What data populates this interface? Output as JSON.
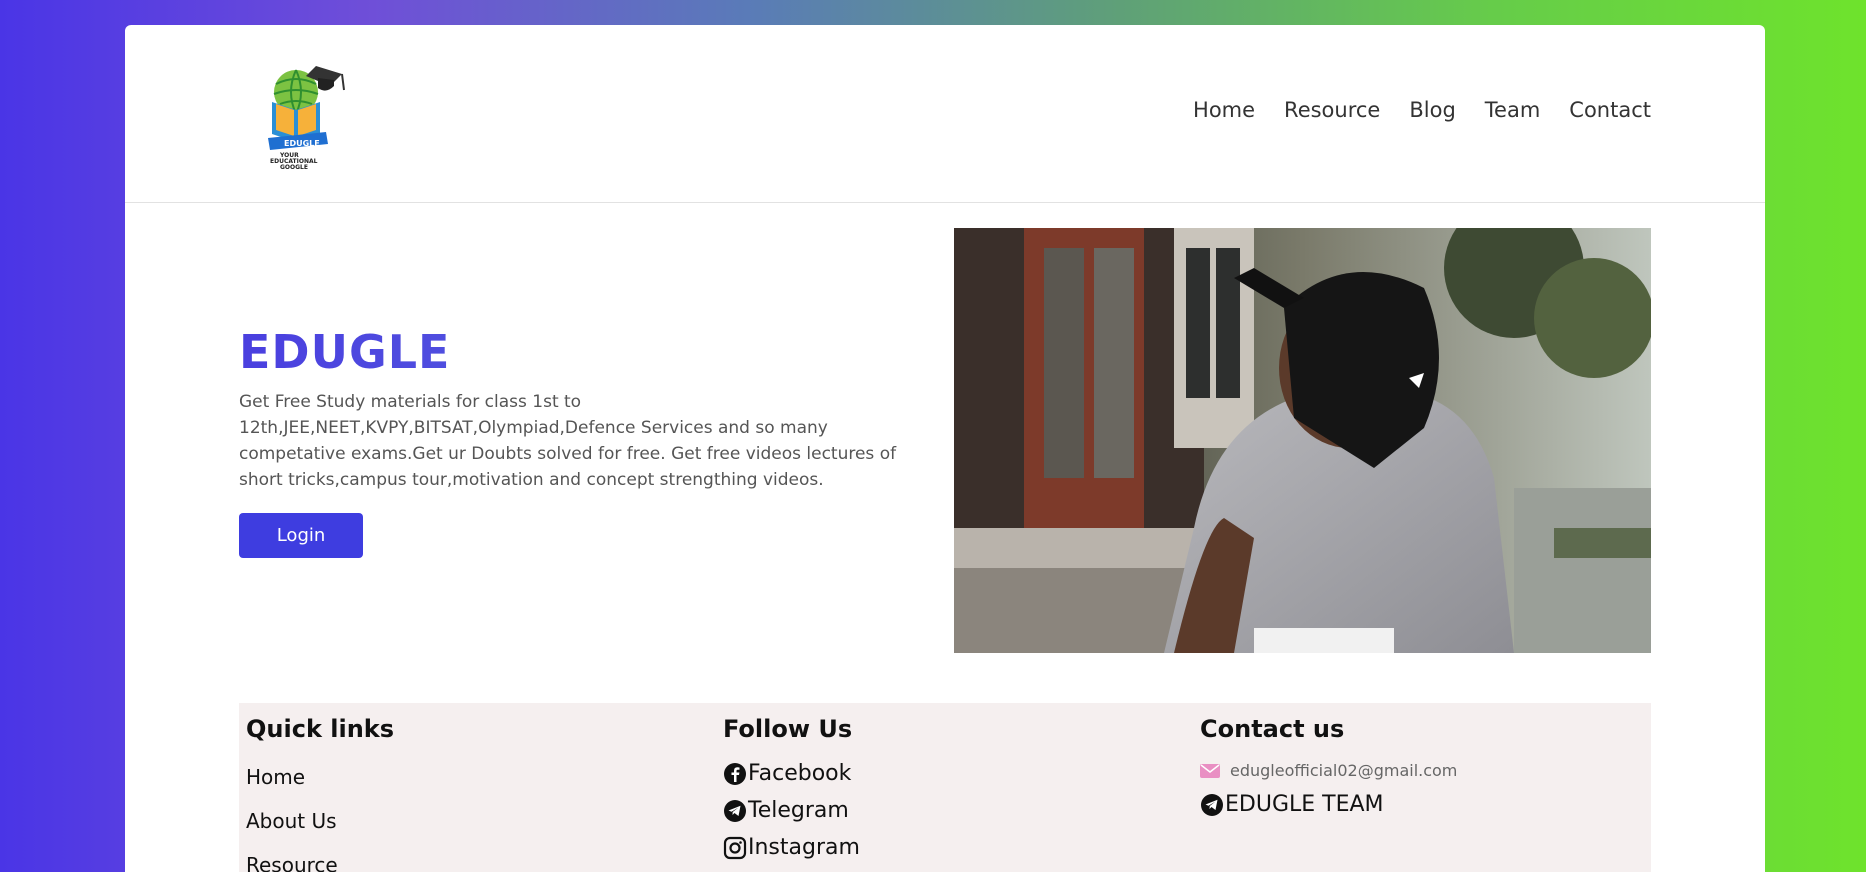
{
  "header": {
    "logo_text": "EDUGLE",
    "logo_tagline": "YOUR EDUCATIONAL GOOGLE",
    "nav": [
      "Home",
      "Resource",
      "Blog",
      "Team",
      "Contact"
    ]
  },
  "hero": {
    "title": "EDUGLE",
    "description": "Get Free Study materials for class 1st to 12th,JEE,NEET,KVPY,BITSAT,Olympiad,Defence Services and so many competative exams.Get ur Doubts solved for free. Get free videos lectures of short tricks,campus tour,motivation and concept strengthing videos.",
    "login_label": "Login"
  },
  "footer": {
    "quick_links": {
      "heading": "Quick links",
      "items": [
        "Home",
        "About Us",
        "Resource"
      ]
    },
    "follow": {
      "heading": "Follow Us",
      "items": [
        {
          "label": "Facebook",
          "icon": "facebook-icon"
        },
        {
          "label": "Telegram",
          "icon": "telegram-icon"
        },
        {
          "label": "Instagram",
          "icon": "instagram-icon"
        }
      ]
    },
    "contact": {
      "heading": "Contact us",
      "email": "edugleofficial02@gmail.com",
      "team": "EDUGLE TEAM"
    }
  },
  "colors": {
    "brand": "#4a3fdf",
    "button": "#3e3de0",
    "footer_bg": "#f5efef",
    "email_icon": "#e98fc3"
  }
}
